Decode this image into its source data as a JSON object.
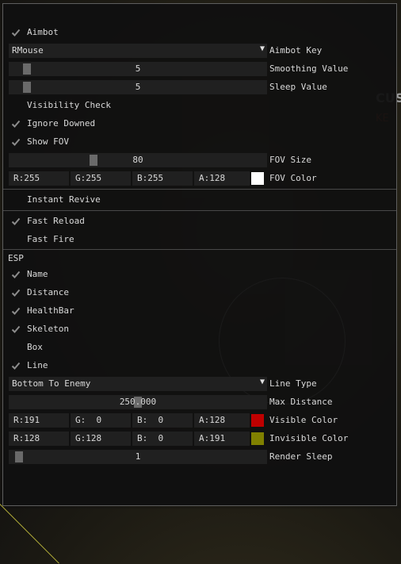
{
  "menu": {
    "aimbot": {
      "label": "Aimbot",
      "checked": true
    },
    "aimbot_key": {
      "value": "RMouse",
      "label": "Aimbot Key",
      "arrow": "▼"
    },
    "smoothing": {
      "value": "5",
      "label": "Smoothing Value",
      "fraction": 0.05
    },
    "sleep": {
      "value": "5",
      "label": "Sleep Value",
      "fraction": 0.05
    },
    "visibility_check": {
      "label": "Visibility Check",
      "checked": false
    },
    "ignore_downed": {
      "label": "Ignore Downed",
      "checked": true
    },
    "show_fov": {
      "label": "Show FOV",
      "checked": true
    },
    "fov_size": {
      "value": "80",
      "label": "FOV Size",
      "fraction": 0.32
    },
    "fov_color": {
      "r": "R:255",
      "g": "G:255",
      "b": "B:255",
      "a": "A:128",
      "label": "FOV Color",
      "swatch": "#ffffff"
    },
    "instant_revive": {
      "label": "Instant Revive",
      "checked": false
    },
    "fast_reload": {
      "label": "Fast Reload",
      "checked": true
    },
    "fast_fire": {
      "label": "Fast Fire",
      "checked": false
    },
    "esp_header": "ESP",
    "esp_name": {
      "label": "Name",
      "checked": true
    },
    "esp_distance": {
      "label": "Distance",
      "checked": true
    },
    "esp_healthbar": {
      "label": "HealthBar",
      "checked": true
    },
    "esp_skeleton": {
      "label": "Skeleton",
      "checked": true
    },
    "esp_box": {
      "label": "Box",
      "checked": false
    },
    "esp_line": {
      "label": "Line",
      "checked": true
    },
    "line_type": {
      "value": "Bottom To Enemy",
      "label": "Line Type",
      "arrow": "▼"
    },
    "max_distance": {
      "value": "250.000",
      "label": "Max Distance",
      "fraction": 0.5
    },
    "visible_color": {
      "r": "R:191",
      "g": "G:  0",
      "b": "B:  0",
      "a": "A:128",
      "label": "Visible Color",
      "swatch": "#bf0000"
    },
    "invisible_color": {
      "r": "R:128",
      "g": "G:128",
      "b": "B:  0",
      "a": "A:191",
      "label": "Invisible Color",
      "swatch": "#808000"
    },
    "render_sleep": {
      "value": "1",
      "label": "Render Sleep",
      "fraction": 0.02
    }
  },
  "background": {
    "brand_text": "CUS",
    "brand_subtext": "KE"
  },
  "colors": {
    "check": "#8c8c8c",
    "grab": "#6a6a6a",
    "frame": "#202020",
    "panel": "#101010"
  }
}
